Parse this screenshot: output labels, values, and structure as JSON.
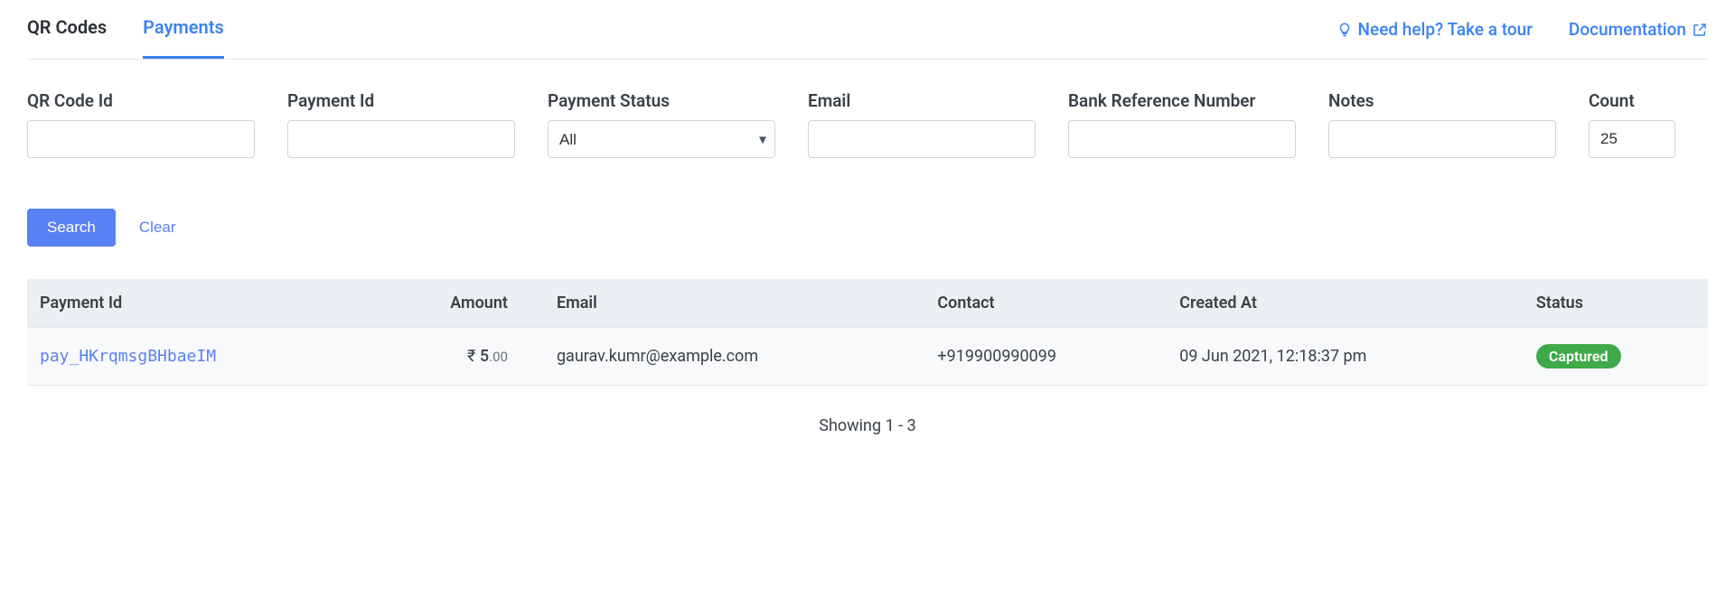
{
  "tabs": {
    "qr": "QR Codes",
    "payments": "Payments"
  },
  "links": {
    "help": "Need help? Take a tour",
    "docs": "Documentation"
  },
  "filters": {
    "qr_code_id": {
      "label": "QR Code Id",
      "value": ""
    },
    "payment_id": {
      "label": "Payment Id",
      "value": ""
    },
    "payment_status": {
      "label": "Payment Status",
      "selected": "All"
    },
    "email": {
      "label": "Email",
      "value": ""
    },
    "bank_ref": {
      "label": "Bank Reference Number",
      "value": ""
    },
    "notes": {
      "label": "Notes",
      "value": ""
    },
    "count": {
      "label": "Count",
      "value": "25"
    }
  },
  "buttons": {
    "search": "Search",
    "clear": "Clear"
  },
  "table": {
    "columns": {
      "payment_id": "Payment Id",
      "amount": "Amount",
      "email": "Email",
      "contact": "Contact",
      "created_at": "Created At",
      "status": "Status"
    },
    "rows": [
      {
        "payment_id": "pay_HKrqmsgBHbaeIM",
        "amount_currency": "₹",
        "amount_int": "5",
        "amount_dec": ".00",
        "email": "gaurav.kumr@example.com",
        "contact": "+919900990099",
        "created_at": "09 Jun 2021, 12:18:37 pm",
        "status": "Captured"
      }
    ]
  },
  "pager": "Showing 1 - 3"
}
